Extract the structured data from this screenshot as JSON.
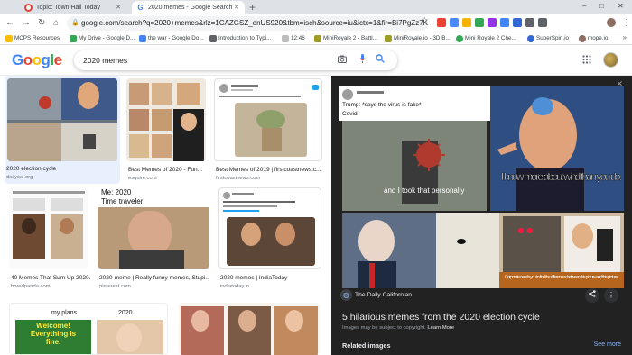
{
  "browser": {
    "tabs": [
      {
        "title": "Topic: Town Hall Today",
        "color": "#db4437"
      },
      {
        "title": "2020 memes - Google Search",
        "color": "#4285f4"
      }
    ],
    "new_tab": "+",
    "window_controls": [
      "–",
      "□",
      "✕"
    ],
    "url": "google.com/search?q=2020+memes&rlz=1CAZGSZ_enUS920&tbm=isch&source=iu&ictx=1&fir=Bi7PgZz7KE98GM...",
    "extensions": [
      {
        "icon": "gmail-icon",
        "color": "#ea4335"
      },
      {
        "icon": "shield-icon",
        "color": "#4a8af4"
      },
      {
        "icon": "color-icon",
        "color": "#f4b400"
      },
      {
        "icon": "y-icon",
        "color": "#34a853"
      },
      {
        "icon": "pen-icon",
        "color": "#9334e6"
      },
      {
        "icon": "circle-icon",
        "color": "#4285f4"
      },
      {
        "icon": "k-icon",
        "color": "#3367d6"
      },
      {
        "icon": "grid-icon",
        "color": "#5f6368"
      },
      {
        "icon": "puzzle-icon",
        "color": "#5f6368"
      }
    ]
  },
  "bookmarks": [
    {
      "label": "MCPS Resources",
      "color": "#fbbc05"
    },
    {
      "label": "My Drive - Google D...",
      "color": "#34a853"
    },
    {
      "label": "the war - Google Do...",
      "color": "#4285f4"
    },
    {
      "label": "Introduction to Typi...",
      "color": "#5f6368"
    },
    {
      "label": "12:46",
      "color": "#5f6368"
    },
    {
      "label": "MiniRoyale 2 - Battl...",
      "color": "#9e9d24"
    },
    {
      "label": "MiniRoyale.io - 3D B...",
      "color": "#9e9d24"
    },
    {
      "label": "Mini Royale 2 Che...",
      "color": "#34a853"
    },
    {
      "label": "SuperSpin.io",
      "color": "#3367d6"
    },
    {
      "label": "mope.io",
      "color": "#5f6368"
    }
  ],
  "google": {
    "logo": [
      "G",
      "o",
      "o",
      "g",
      "l",
      "e"
    ],
    "query": "2020 memes"
  },
  "results": [
    {
      "title": "2020 election cycle",
      "source": "dailycal.org"
    },
    {
      "title": "Best Memes of 2020 - Fun...",
      "source": "esquire.com"
    },
    {
      "title": "Best Memes of 2019 | firstcoastnews.c...",
      "source": "firstcoastnews.com"
    },
    {
      "title": "40 Memes That Sum Up 2020...",
      "source": "boredpanda.com"
    },
    {
      "title": "2020-meme | Really funny memes, Stupi...",
      "source": "pinterest.com",
      "caption_top": "Me: 2020",
      "caption_mid": "Time traveler:"
    },
    {
      "title": "2020 memes | IndiaToday",
      "source": "indiatoday.in"
    },
    {
      "title": "",
      "source": "",
      "caption_left": "my plans",
      "caption_right": "2020",
      "caption_sign": "Welcome! Everything is fine."
    },
    {
      "title": "",
      "source": ""
    }
  ],
  "preview": {
    "meme_top_text": "Trump: *says the virus is fake*",
    "meme_covid_text": "Covid:",
    "meme_took_text": "and I took that personally",
    "meme_wind_text": "I know more about wind than you do.",
    "meme_corporate_text": "Corporate needs you to find the differences between this picture and this picture.",
    "source": "The Daily Californian",
    "title": "5 hilarious memes from the 2020 election cycle",
    "copyright": "Images may be subject to copyright.",
    "learn_more": "Learn More",
    "related": "Related images",
    "see_more": "See more"
  }
}
